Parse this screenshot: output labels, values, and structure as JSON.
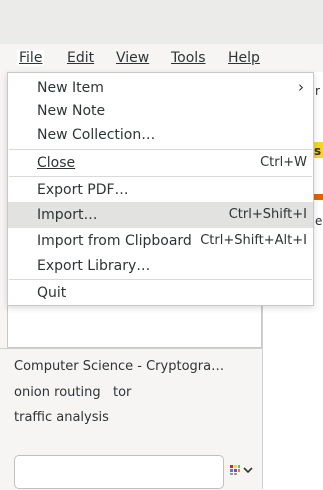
{
  "menubar": {
    "items": [
      {
        "label": "File",
        "active": true
      },
      {
        "label": "Edit"
      },
      {
        "label": "View"
      },
      {
        "label": "Tools"
      },
      {
        "label": "Help"
      }
    ]
  },
  "file_menu": {
    "items": [
      {
        "label": "New Item",
        "submenu_arrow": "›"
      },
      {
        "label": "New Note"
      },
      {
        "label": "New Collection…"
      },
      {
        "label": "Close",
        "shortcut": "Ctrl+W"
      },
      {
        "label": "Export PDF…"
      },
      {
        "label": "Import…",
        "shortcut": "Ctrl+Shift+I",
        "highlighted": true
      },
      {
        "label": "Import from Clipboard",
        "shortcut": "Ctrl+Shift+Alt+I"
      },
      {
        "label": "Export Library…"
      },
      {
        "label": "Quit"
      }
    ]
  },
  "tags": {
    "lines": [
      "Computer Science - Cryptogra…",
      "onion routing   tor",
      "traffic analysis"
    ],
    "search": {
      "placeholder": "",
      "value": ""
    }
  },
  "right_pane": {
    "peek_chars": [
      "r",
      "s",
      "e"
    ]
  },
  "colors": {
    "menu_highlight": "#e2e2e0",
    "peek_yellow": "#f6d32d",
    "peek_orange": "#e66100"
  }
}
